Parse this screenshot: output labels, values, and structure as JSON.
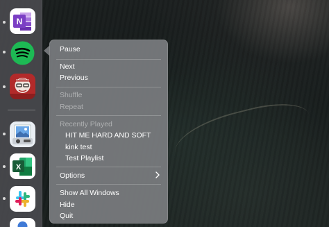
{
  "desktop": {
    "description_colors": {
      "dock_bg": "#4b4b50",
      "menu_bg": "#7a7c7f"
    }
  },
  "dock": {
    "apps": [
      {
        "name": "onenote",
        "icon": "onenote-icon",
        "running": true,
        "color": "#7b3fc4"
      },
      {
        "name": "spotify",
        "icon": "spotify-icon",
        "running": true,
        "color": "#1db954"
      },
      {
        "name": "app-avatar",
        "icon": "avatar-app-icon",
        "running": true,
        "color": "#b22a2a"
      },
      {
        "name": "preview",
        "icon": "preview-icon",
        "running": true,
        "color": "#5b8fd6"
      },
      {
        "name": "excel",
        "icon": "excel-icon",
        "running": true,
        "color": "#1d7044"
      },
      {
        "name": "slack",
        "icon": "slack-icon",
        "running": true,
        "color": "#ffffff"
      },
      {
        "name": "partial",
        "icon": "partial-app-icon",
        "running": false,
        "color": "#3f7ad6"
      }
    ],
    "excel_letter": "X",
    "onenote_letter": "N"
  },
  "menu": {
    "pause": "Pause",
    "next": "Next",
    "previous": "Previous",
    "shuffle": "Shuffle",
    "repeat": "Repeat",
    "recently_played_header": "Recently Played",
    "recent": [
      "HIT ME HARD AND SOFT",
      "kink test",
      "Test Playlist"
    ],
    "options": "Options",
    "show_all_windows": "Show All Windows",
    "hide": "Hide",
    "quit": "Quit"
  }
}
